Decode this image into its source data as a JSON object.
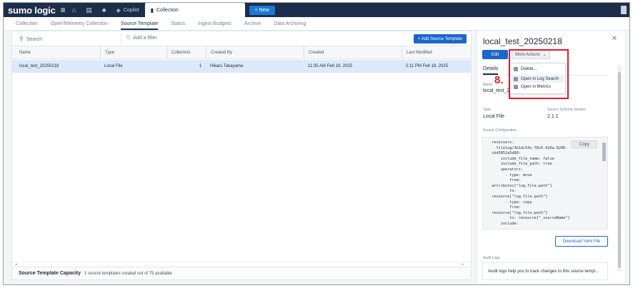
{
  "topbar": {
    "logo": "sumo logic",
    "menu_glyph": "≡",
    "icons": [
      "home-icon",
      "files-icon",
      "bell-icon"
    ],
    "tabs": [
      {
        "label": "Copilot",
        "icon": "copilot-icon"
      },
      {
        "label": "Collection",
        "icon": "collection-icon",
        "active": true
      }
    ],
    "new_button": "+ New"
  },
  "subnav": {
    "items": [
      "Collection",
      "OpenTelemetry Collection",
      "Source Template",
      "Status",
      "Ingest Budgets",
      "Archive",
      "Data Archiving"
    ],
    "active": "Source Template"
  },
  "toolbar": {
    "search_placeholder": "Search",
    "filter_label": "Add a filter",
    "add_source_label": "+ Add Source Template"
  },
  "table": {
    "columns": [
      "Name",
      "Type",
      "Collectors",
      "Created By",
      "Created",
      "Last Modified"
    ],
    "rows": [
      {
        "name": "local_test_20250218",
        "type": "Local File",
        "collectors": "1",
        "created_by": "Hikaru Takayama",
        "created": "11:35 AM Feb 18, 2025",
        "modified": "2:11 PM Feb 18, 2025"
      }
    ]
  },
  "footer": {
    "title": "Source Template Capacity",
    "status": "1 source templates created out of 75 available"
  },
  "detail": {
    "title": "local_test_20250218",
    "edit_label": "Edit",
    "more_actions_label": "More Actions",
    "tab": "Details",
    "name_label": "Name",
    "name_value": "local_test_20",
    "type_label": "Type",
    "type_value": "Local File",
    "schema_label": "Source Schema Version",
    "schema_value": "2.1.1",
    "config_label": "Source Configuration",
    "copy_label": "Copy",
    "config_yaml": "  receivers:\n    filelog/3b1dc54c-78c6-426a-8206-\n  cbd5852a5d80:\n      include_file_name: false\n      include_file_path: true\n      operators:\n        - type: move\n          from:\n  attributes[\"log.file.path\"]\n          to:\n  resource[\"log.file.path\"]\n        - type: copy\n          from:\n  resource[\"log.file.path\"]\n          to: resource[\"_sourceName\"]\n      include:",
    "download_label": "Download Yaml File",
    "audit_label": "Audit Logs",
    "audit_text": "Audit logs help you to track changes to this source templ..."
  },
  "dropdown": {
    "items": [
      {
        "label": "Delete...",
        "icon": "trash-icon"
      },
      {
        "label": "Open in Log Search",
        "icon": "log-search-icon"
      },
      {
        "label": "Open in Metrics",
        "icon": "metrics-icon"
      }
    ]
  },
  "annotation": {
    "step": "8.",
    "color": "#e0192c"
  },
  "colors": {
    "topbar": "#1c2e4a",
    "primary": "#1b66c9",
    "selected_row": "#dce9fb"
  }
}
